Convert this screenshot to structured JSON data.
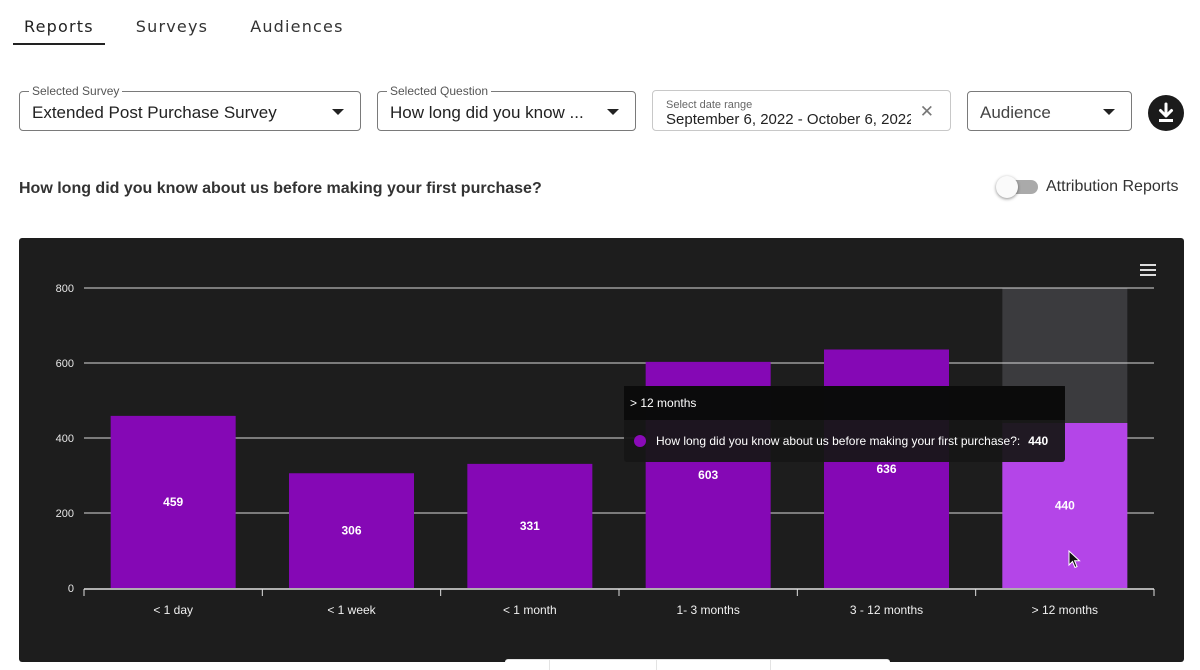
{
  "tabs": [
    {
      "label": "Reports",
      "active": true
    },
    {
      "label": "Surveys",
      "active": false
    },
    {
      "label": "Audiences",
      "active": false
    }
  ],
  "filters": {
    "survey": {
      "label": "Selected Survey",
      "value": "Extended Post Purchase Survey"
    },
    "question": {
      "label": "Selected Question",
      "value": "How long did you know ..."
    },
    "date_range": {
      "label": "Select date range",
      "value": "September 6, 2022 - October 6, 2022"
    },
    "audience": {
      "value": "Audience"
    }
  },
  "question_title": "How long did you know about us before making your first purchase?",
  "attribution_toggle": {
    "label": "Attribution Reports",
    "on": false
  },
  "icons": {
    "download": "download-icon",
    "menu": "hamburger-menu-icon",
    "clear": "close-icon",
    "dropdown": "caret-down-icon",
    "cursor": "mouse-pointer-icon"
  },
  "colors": {
    "bar": "#8508b5",
    "bar_highlight": "#b445e8",
    "panel_bg": "#1d1d1d"
  },
  "tooltip": {
    "header": "> 12 months",
    "series_label": "How long did you know about us before making your first purchase?:",
    "value": "440"
  },
  "chart_data": {
    "type": "bar",
    "categories": [
      "< 1 day",
      "< 1 week",
      "< 1 month",
      "1- 3 months",
      "3 - 12 months",
      "> 12 months"
    ],
    "values": [
      459,
      306,
      331,
      603,
      636,
      440
    ],
    "ylim": [
      0,
      800
    ],
    "yticks": [
      0,
      200,
      400,
      600,
      800
    ],
    "grid": true,
    "highlighted_index": 5,
    "title": "",
    "xlabel": "",
    "ylabel": ""
  }
}
